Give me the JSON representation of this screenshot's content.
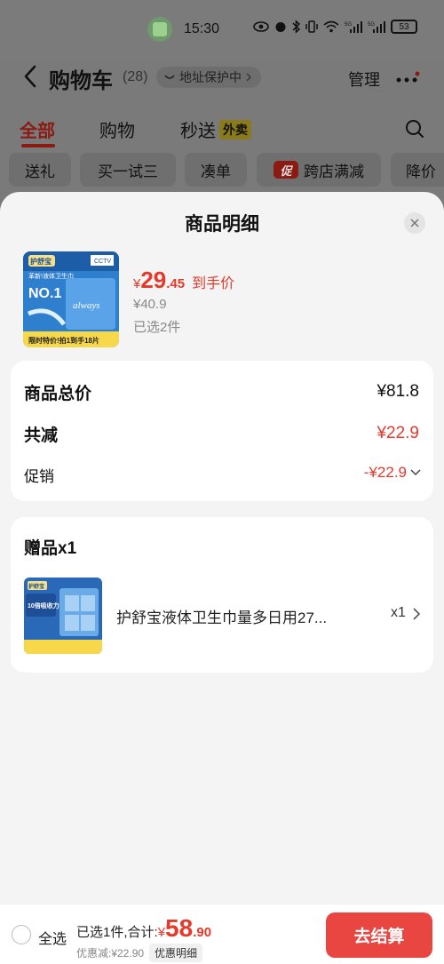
{
  "status_bar": {
    "time": "15:30",
    "battery": "53",
    "icons": [
      "eye-icon",
      "alarm-icon",
      "bluetooth-icon",
      "vibrate-icon",
      "wifi-icon",
      "signal-5g-icon",
      "signal-5g-icon",
      "battery-icon"
    ]
  },
  "header": {
    "title": "购物车",
    "count": "(28)",
    "address_chip": "地址保护中",
    "manage": "管理"
  },
  "tabs": [
    {
      "label": "全部",
      "active": true
    },
    {
      "label": "购物",
      "active": false
    },
    {
      "label": "秒送",
      "active": false,
      "badge": "外卖"
    }
  ],
  "chips": [
    {
      "label": "送礼"
    },
    {
      "label": "买一试三"
    },
    {
      "label": "凑单"
    },
    {
      "label": "跨店满减",
      "badge": "促"
    },
    {
      "label": "降价"
    }
  ],
  "sheet": {
    "title": "商品明细",
    "product": {
      "price_symbol": "¥",
      "price_int": "29",
      "price_dec": ".45",
      "price_note": "到手价",
      "original_price": "¥40.9",
      "selected": "已选2件",
      "thumb_text": {
        "brand": "护舒宝",
        "tag": "CCTV",
        "headline": "革新!液体卫生巾",
        "badge": "NO.1",
        "product": "always",
        "footer": "限时特价!拍1到手18片"
      }
    },
    "summary": {
      "total_label": "商品总价",
      "total_value": "¥81.8",
      "reduce_label": "共减",
      "reduce_value": "¥22.9",
      "promo_label": "促销",
      "promo_value": "-¥22.9"
    },
    "gift": {
      "title": "赠品x1",
      "name": "护舒宝液体卫生巾量多日用27...",
      "qty": "x1",
      "thumb_text": {
        "brand": "护舒宝",
        "headline": "10倍吸收力"
      }
    }
  },
  "bottom_bar": {
    "select_all": "全选",
    "total_label": "已选1件,合计:",
    "total_symbol": "¥",
    "total_int": "58",
    "total_dec": ".90",
    "discount": "优惠减:¥22.90",
    "detail_button": "优惠明细",
    "checkout": "去结算"
  },
  "colors": {
    "accent_red": "#e33a2c",
    "checkout_bg": "#e94641",
    "overlay_dim": "#7a7a7a",
    "sheet_bg": "#f4f4f4"
  }
}
